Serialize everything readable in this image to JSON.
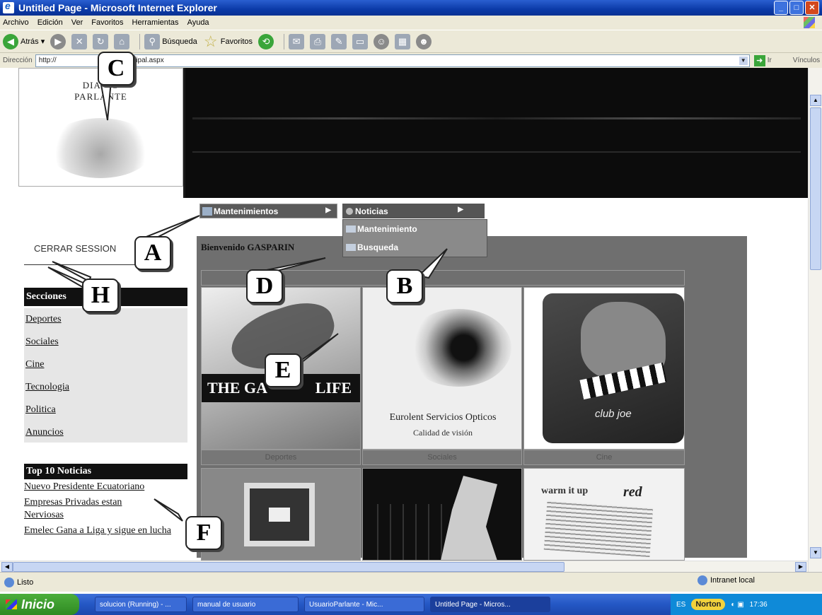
{
  "window": {
    "title": "Untitled Page - Microsoft Internet Explorer"
  },
  "menubar": [
    "Archivo",
    "Edición",
    "Ver",
    "Favoritos",
    "Herramientas",
    "Ayuda"
  ],
  "toolbar": {
    "back": "Atrás",
    "search": "Búsqueda",
    "favorites": "Favoritos"
  },
  "address": {
    "label": "Dirección",
    "url": "http://",
    "url_tail": "2/sitio/principal.aspx",
    "go": "Ir",
    "links": "Vínculos"
  },
  "page": {
    "logo_line1": "DIARIO",
    "logo_line2": "PARLANTE",
    "menu_main": "Mantenimientos",
    "menu_sub": "Noticias",
    "flyout": [
      "Mantenimiento",
      "Busqueda"
    ],
    "logout": "CERRAR SESSION",
    "welcome": "Bienvenido GASPARIN",
    "sections_title": "Secciones",
    "sections": [
      "Deportes",
      "Sociales",
      "Cine",
      "Tecnologia",
      "Politica",
      "Anuncios"
    ],
    "top_title": "Top 10 Noticias",
    "top_news": [
      "Nuevo Presidente Ecuatoriano",
      "Empresas Privadas estan Nerviosas",
      "Emelec Gana a Liga y sigue en lucha"
    ],
    "tiles": {
      "t1_text": "THE GA",
      "t1_text2": "LIFE",
      "t2_text": "Eurolent Servicios Opticos",
      "t2_text2": "Calidad de visión",
      "t3_text": "club joe",
      "t6_text": "warm it up",
      "t6_text2": "red"
    },
    "captions": [
      "Deportes",
      "Sociales",
      "Cine"
    ]
  },
  "callouts": [
    "A",
    "B",
    "C",
    "D",
    "E",
    "F",
    "H"
  ],
  "status": {
    "text": "Listo",
    "zone": "Intranet local"
  },
  "taskbar": {
    "start": "Inicio",
    "tasks": [
      "solucion (Running) - ...",
      "manual de usuario",
      "UsuarioParlante - Mic...",
      "Untitled Page - Micros..."
    ],
    "lang": "ES",
    "norton": "Norton",
    "time": "17:36"
  }
}
